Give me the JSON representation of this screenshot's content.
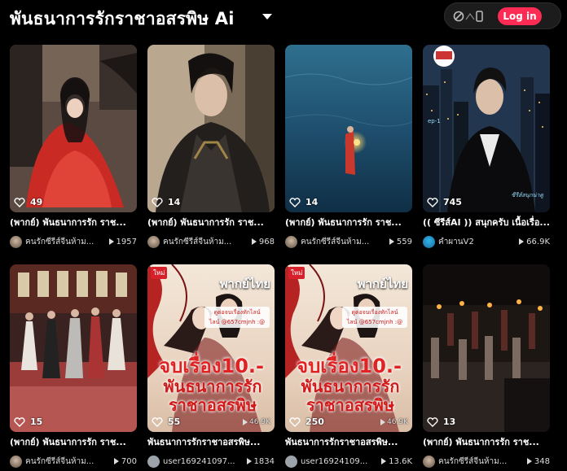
{
  "header": {
    "title": "พันธนาการรักราชาอสรพิษ Ai",
    "login_label": "Log in"
  },
  "cards": [
    {
      "likes": "49",
      "caption": "(พากย์) พันธนาการรัก ราช...",
      "author": "คนรักซีรีส์จีนห้าม...",
      "views": "1957",
      "thumb_views": ""
    },
    {
      "likes": "14",
      "caption": "(พากย์) พันธนาการรัก ราช...",
      "author": "คนรักซีรีส์จีนห้าม...",
      "views": "968",
      "thumb_views": ""
    },
    {
      "likes": "14",
      "caption": "(พากย์) พันธนาการรัก ราช...",
      "author": "คนรักซีรีส์จีนห้าม...",
      "views": "559",
      "thumb_views": ""
    },
    {
      "likes": "745",
      "caption": "(( ซีรีส์AI )) สนุกครับ เนื้อเรื่อ...",
      "author": "คําผานV2",
      "views": "66.9K",
      "thumb_views": ""
    },
    {
      "likes": "15",
      "caption": "(พากย์) พันธนาการรัก ราช...",
      "author": "คนรักซีรีส์จีนห้าม...",
      "views": "700",
      "thumb_views": ""
    },
    {
      "likes": "55",
      "caption": "พันธนาการรักราชาอสรพิษ...",
      "author": "user169241097...",
      "views": "1834",
      "thumb_views": "46.9K"
    },
    {
      "likes": "250",
      "caption": "พันธนาการรักราชาอสรพิษ...",
      "author": "user16924109...",
      "views": "13.6K",
      "thumb_views": "46.9K"
    },
    {
      "likes": "13",
      "caption": "(พากย์) พันธนาการรัก ราช...",
      "author": "คนรักซีรีส์จีนห้าม...",
      "views": "348",
      "thumb_views": ""
    }
  ],
  "poster": {
    "badge": "ใหม่",
    "top": "พากย์ไทย",
    "contact_line1": "ดูต่อจบเรื่องทักไลน์",
    "contact_line2": "ไลน์ @657cmjnh :@",
    "deal": "จบเรื่อง10.-",
    "name_line1": "พันธนาการรัก",
    "name_line2": "ราชาอสรพิษ"
  },
  "thumb4_text": {
    "ep": "ep-1",
    "watermark": "ซีรีส์สนุกน่าดู"
  },
  "colors": {
    "accent": "#fe2c55",
    "background": "#000000"
  }
}
